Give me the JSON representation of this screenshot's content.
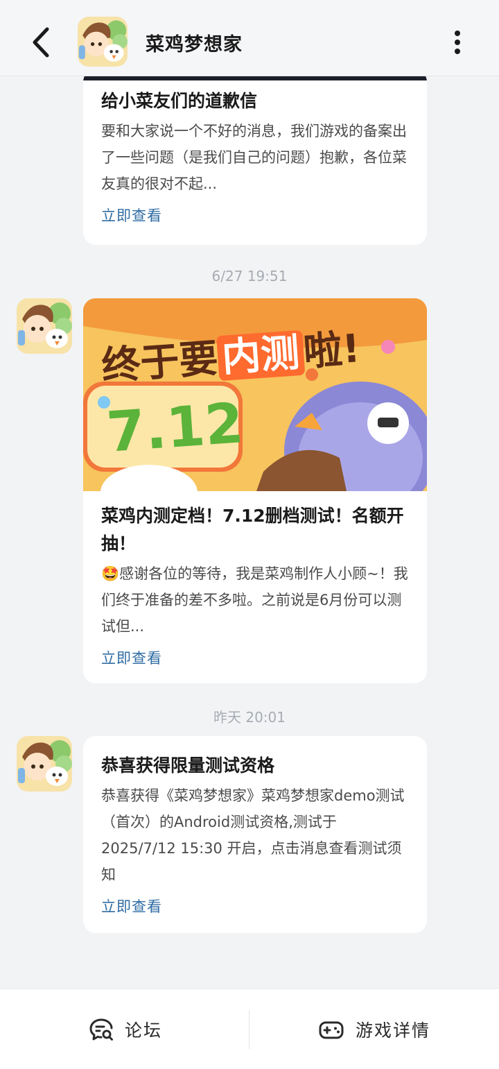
{
  "header": {
    "title": "菜鸡梦想家"
  },
  "messages": [
    {
      "title": "给小菜友们的道歉信",
      "description": "要和大家说一个不好的消息，我们游戏的备案出了一些问题（是我们自己的问题）抱歉，各位菜友真的很对不起...",
      "link": "立即查看"
    },
    {
      "timestamp": "6/27 19:51",
      "banner": {
        "headline_prefix": "终于要",
        "headline_highlight": "内测",
        "headline_suffix": "啦!",
        "date": "7.12"
      },
      "title": "菜鸡内测定档！7.12删档测试！名额开抽！",
      "description": "🤩感谢各位的等待，我是菜鸡制作人小顾~！我们终于准备的差不多啦。之前说是6月份可以测试但...",
      "link": "立即查看"
    },
    {
      "timestamp": "昨天 20:01",
      "title": "恭喜获得限量测试资格",
      "description": "恭喜获得《菜鸡梦想家》菜鸡梦想家demo测试（首次）的Android测试资格,测试于2025/7/12 15:30 开启，点击消息查看测试须知",
      "link": "立即查看"
    }
  ],
  "bottom_bar": {
    "forum_label": "论坛",
    "forum_icon": "chat-search-icon",
    "game_label": "游戏详情",
    "game_icon": "gamepad-icon"
  },
  "colors": {
    "link": "#2f6ca3",
    "timestamp": "#a7abb2",
    "background": "#f2f3f5"
  }
}
